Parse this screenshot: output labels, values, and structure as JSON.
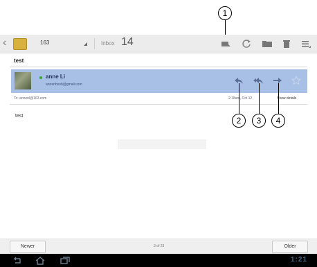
{
  "callouts": [
    "1",
    "2",
    "3",
    "4"
  ],
  "topbar": {
    "account": "163",
    "folder_label": "Inbox",
    "folder_count": "14",
    "actions": [
      "mark-unread-icon",
      "refresh-icon",
      "move-to-folder-icon",
      "delete-icon",
      "menu-icon"
    ]
  },
  "message": {
    "subject": "test",
    "sender_name": "anne Li",
    "sender_email": "annenhsoh@gmail.com",
    "to_label": "To: annenl@163.com",
    "date": "2:18am, Oct 12",
    "show_details": "Show details",
    "body": "test",
    "actions": [
      "reply-icon",
      "reply-all-icon",
      "forward-icon",
      "star-icon"
    ]
  },
  "footer": {
    "newer": "Newer",
    "pager": "3 of 23",
    "older": "Older"
  },
  "system_bar": {
    "icons": [
      "back-icon",
      "home-icon",
      "recent-apps-icon"
    ],
    "clock": "1:21"
  }
}
